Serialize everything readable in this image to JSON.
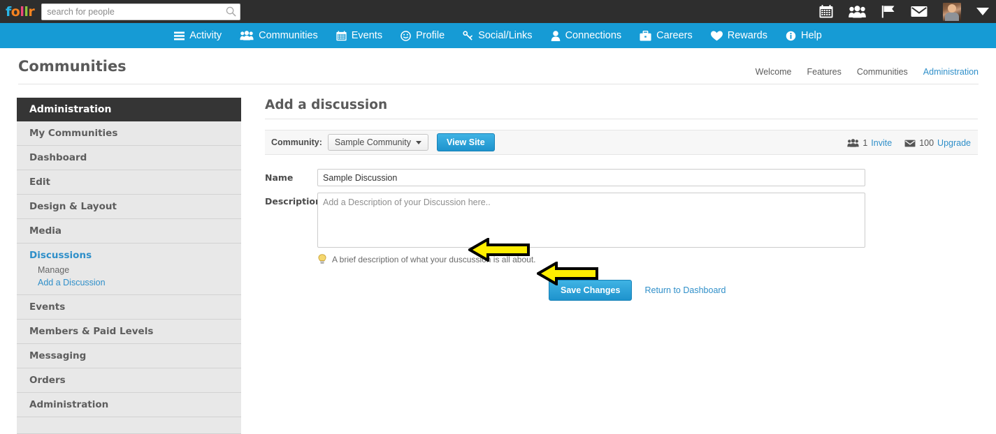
{
  "topbar": {
    "logo_letters": [
      "f",
      "o",
      "l",
      "l",
      "r"
    ],
    "search": {
      "placeholder": "search for people",
      "value": ""
    },
    "icons": [
      "calendar-icon",
      "people-icon",
      "flag-icon",
      "envelope-icon",
      "avatar",
      "caret-down-icon"
    ]
  },
  "nav": {
    "items": [
      {
        "label": "Activity",
        "icon": "list-icon"
      },
      {
        "label": "Communities",
        "icon": "people-icon"
      },
      {
        "label": "Events",
        "icon": "calendar-icon"
      },
      {
        "label": "Profile",
        "icon": "smiley-icon"
      },
      {
        "label": "Social/Links",
        "icon": "link-icon"
      },
      {
        "label": "Connections",
        "icon": "user-icon"
      },
      {
        "label": "Careers",
        "icon": "briefcase-icon"
      },
      {
        "label": "Rewards",
        "icon": "heart-icon"
      },
      {
        "label": "Help",
        "icon": "info-icon"
      }
    ]
  },
  "page": {
    "title": "Communities",
    "breadcrumbs": [
      {
        "label": "Welcome",
        "active": false
      },
      {
        "label": "Features",
        "active": false
      },
      {
        "label": "Communities",
        "active": false
      },
      {
        "label": "Administration",
        "active": true
      }
    ]
  },
  "sidebar": {
    "header": "Administration",
    "items": [
      {
        "label": "My Communities"
      },
      {
        "label": "Dashboard"
      },
      {
        "label": "Edit"
      },
      {
        "label": "Design & Layout"
      },
      {
        "label": "Media"
      }
    ],
    "group": {
      "title": "Discussions",
      "sub": [
        {
          "label": "Manage",
          "active": false
        },
        {
          "label": "Add a Discussion",
          "active": true
        }
      ]
    },
    "items_after": [
      {
        "label": "Events"
      },
      {
        "label": "Members & Paid Levels"
      },
      {
        "label": "Messaging"
      },
      {
        "label": "Orders"
      },
      {
        "label": "Administration"
      }
    ]
  },
  "main": {
    "title": "Add a discussion",
    "toolbar": {
      "community_label": "Community:",
      "community_value": "Sample Community",
      "view_site_label": "View Site",
      "invite_count": "1",
      "invite_label": "Invite",
      "upgrade_count": "100",
      "upgrade_label": "Upgrade"
    },
    "form": {
      "name_label": "Name",
      "name_value": "Sample Discussion",
      "description_label": "Description",
      "description_placeholder": "Add a Description of your Discussion here..",
      "description_value": "",
      "hint": "A brief description of what your duscussion is all about.",
      "save_label": "Save Changes",
      "return_label": "Return to Dashboard"
    }
  },
  "colors": {
    "brand_blue": "#169bd5",
    "link_blue": "#2f8fc9",
    "topbar_dark": "#2e2e2e",
    "sidebar_header": "#353535",
    "sidebar_item": "#e8e8e8",
    "annotation_yellow": "#ffee00"
  }
}
